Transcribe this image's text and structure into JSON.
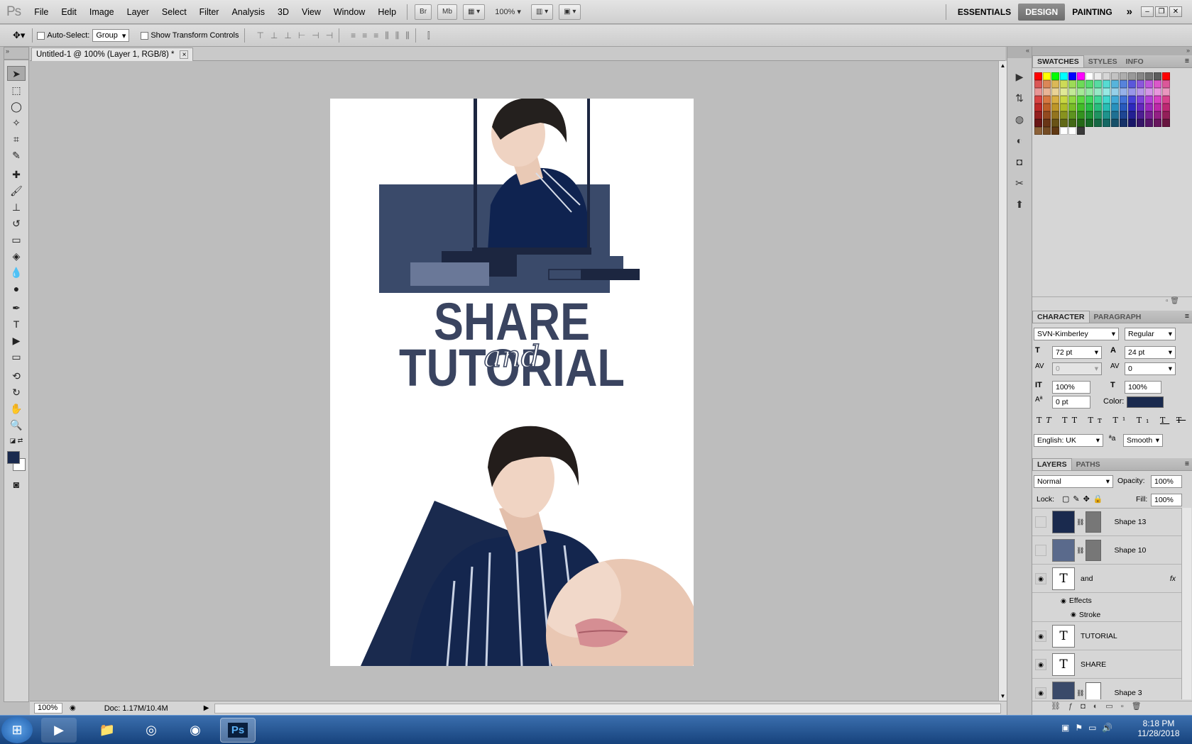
{
  "menubar": {
    "logo": "Ps",
    "items": [
      "File",
      "Edit",
      "Image",
      "Layer",
      "Select",
      "Filter",
      "Analysis",
      "3D",
      "View",
      "Window",
      "Help"
    ],
    "bridge": "Br",
    "minibridge": "Mb",
    "zoom": "100%",
    "workspaces": [
      "ESSENTIALS",
      "DESIGN",
      "PAINTING"
    ],
    "more": "»"
  },
  "options": {
    "auto_select_label": "Auto-Select:",
    "auto_select_value": "Group",
    "transform_label": "Show Transform Controls"
  },
  "document": {
    "tab_title": "Untitled-1 @ 100% (Layer 1, RGB/8) *",
    "close": "×"
  },
  "artwork": {
    "title_top": "SHARE",
    "title_script": "and",
    "title_bottom": "TUTORIAL",
    "colors": {
      "navy": "#1a2a4e",
      "slate": "#3a4a6a",
      "lavender": "#6a7898",
      "dark": "#1c2640"
    }
  },
  "status": {
    "zoom": "100%",
    "doc": "Doc: 1.17M/10.4M"
  },
  "swatches_panel": {
    "tabs": [
      "SWATCHES",
      "STYLES",
      "INFO"
    ]
  },
  "character": {
    "tabs": [
      "CHARACTER",
      "PARAGRAPH"
    ],
    "font_family": "SVN-Kimberley",
    "font_style": "Regular",
    "size": "72 pt",
    "leading": "24 pt",
    "kerning": "0",
    "tracking": "0",
    "vscale": "100%",
    "hscale": "100%",
    "baseline": "0 pt",
    "color_label": "Color:",
    "color_value": "#1a2a4e",
    "language": "English: UK",
    "aa_label": "a",
    "aa_value": "Smooth"
  },
  "layers_panel": {
    "tabs": [
      "LAYERS",
      "PATHS"
    ],
    "blend_mode": "Normal",
    "opacity_label": "Opacity:",
    "opacity": "100%",
    "lock_label": "Lock:",
    "fill_label": "Fill:",
    "fill": "100%",
    "layers": [
      {
        "name": "Shape 13",
        "type": "shape",
        "visible": false,
        "color": "#1a2a4e"
      },
      {
        "name": "Shape 10",
        "type": "shape",
        "visible": false,
        "color": "#5a6a8c"
      },
      {
        "name": "and",
        "type": "text",
        "visible": true,
        "fx": "fx"
      },
      {
        "name": "Effects",
        "type": "effect",
        "visible": true
      },
      {
        "name": "Stroke",
        "type": "effect",
        "visible": true
      },
      {
        "name": "TUTORIAL",
        "type": "text",
        "visible": true
      },
      {
        "name": "SHARE",
        "type": "text",
        "visible": true
      },
      {
        "name": "Shape 3",
        "type": "shape",
        "visible": true,
        "color": "#3a4a6a"
      }
    ],
    "text_thumb": "T"
  },
  "taskbar": {
    "time": "8:18 PM",
    "date": "11/28/2018",
    "ps": "Ps"
  }
}
